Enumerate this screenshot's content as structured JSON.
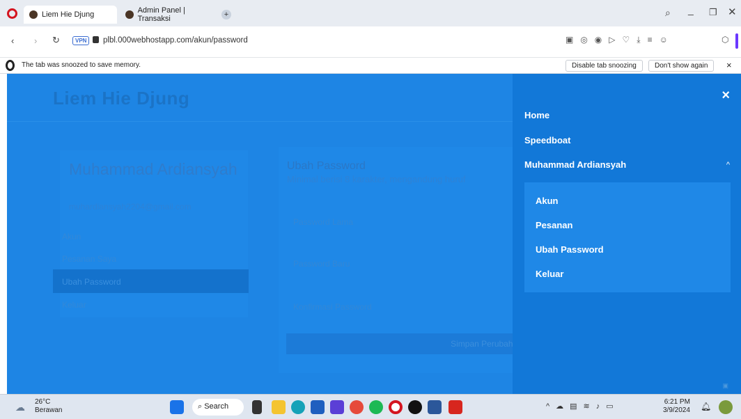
{
  "browser": {
    "tabs": [
      {
        "label": "Liem Hie Djung"
      },
      {
        "label": "Admin Panel | Transaksi"
      }
    ],
    "new_tab": "+",
    "vpn_badge": "VPN",
    "url": "plbl.000webhostapp.com/akun/password"
  },
  "snooze": {
    "message": "The tab was snoozed to save memory.",
    "disable_label": "Disable tab snoozing",
    "dont_show_label": "Don't show again",
    "close": "×"
  },
  "site": {
    "title": "Liem Hie Djung",
    "user_name": "Muhammad Ardiansyah",
    "user_email": "muhardiansyah2204@gmail.com",
    "left_menu": [
      "Akun",
      "Pesanan Saya",
      "Ubah Password",
      "Keluar"
    ],
    "form": {
      "title": "Ubah Password",
      "subtitle": "Minimal berisi 8 karakter, mengandung huruf",
      "field_old": "Password Lama",
      "field_new": "Password Baru",
      "field_confirm": "Konfirmasi Password",
      "save_label": "Simpan Perubahan"
    }
  },
  "panel": {
    "close": "×",
    "items": [
      "Home",
      "Speedboat",
      "Muhammad Ardiansyah"
    ],
    "sub_items": [
      "Akun",
      "Pesanan",
      "Ubah Password",
      "Keluar"
    ],
    "caret": "^"
  },
  "taskbar": {
    "temp": "26°C",
    "condition": "Berawan",
    "search": "Search",
    "time": "6:21 PM",
    "date": "3/9/2024"
  },
  "colors": {
    "page_overlay": "#1e85e4",
    "panel": "#1278d8"
  }
}
